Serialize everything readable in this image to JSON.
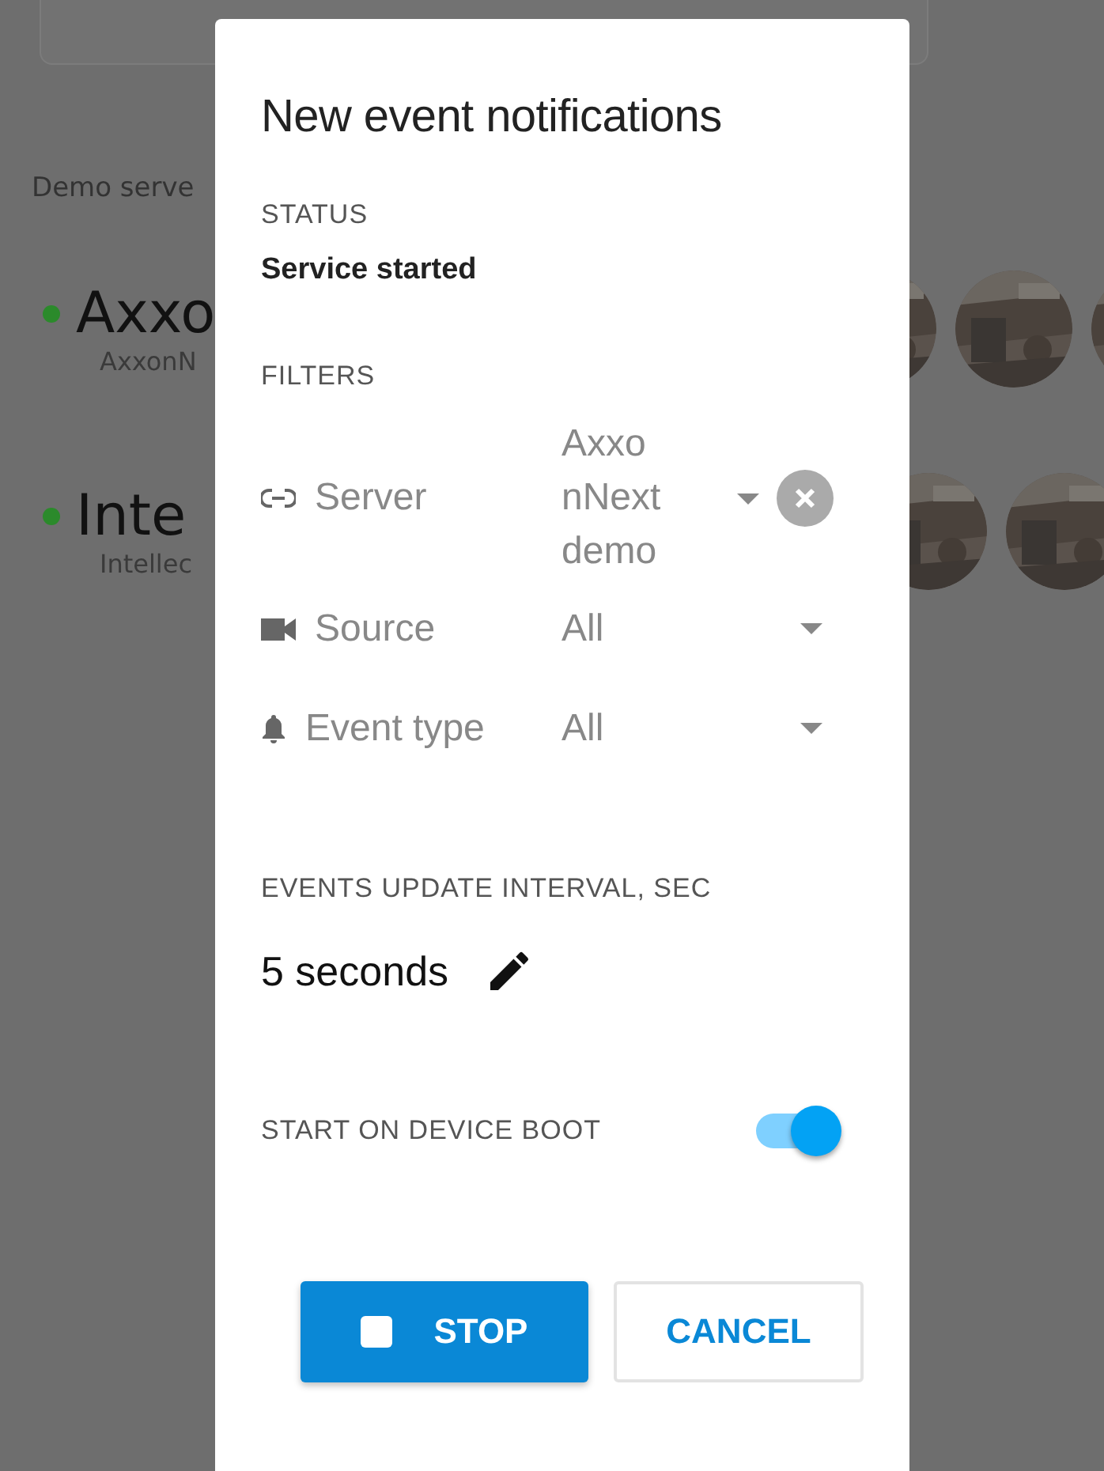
{
  "background": {
    "section_label": "Demo serve",
    "servers": [
      {
        "name": "Axxo",
        "subtitle": "AxxonN"
      },
      {
        "name": "Inte",
        "subtitle": "Intellec"
      }
    ]
  },
  "dialog": {
    "title": "New event notifications",
    "status_label": "STATUS",
    "status_value": "Service started",
    "filters_label": "FILTERS",
    "filters": [
      {
        "kind": "server",
        "label": "Server",
        "value": "AxxonNext demo",
        "clearable": true
      },
      {
        "kind": "source",
        "label": "Source",
        "value": "All",
        "clearable": false
      },
      {
        "kind": "event_type",
        "label": "Event type",
        "value": "All",
        "clearable": false
      }
    ],
    "interval_label": "EVENTS UPDATE INTERVAL, SEC",
    "interval_value": "5 seconds",
    "boot_label": "START ON DEVICE BOOT",
    "boot_toggle": {
      "on": true
    },
    "buttons": [
      {
        "kind": "primary",
        "label": "STOP"
      },
      {
        "kind": "secondary",
        "label": "CANCEL"
      }
    ]
  }
}
